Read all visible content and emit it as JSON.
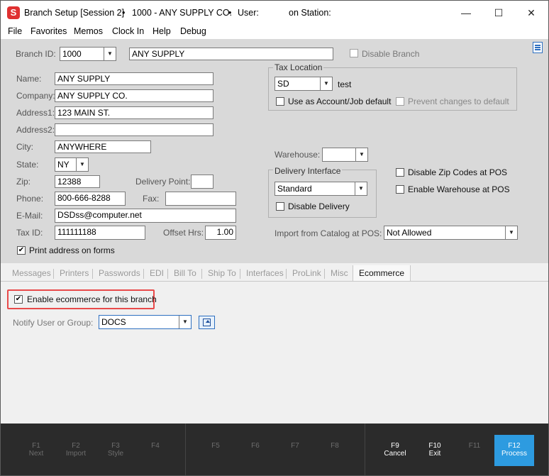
{
  "window": {
    "title_app": "Branch Setup [Session 2]",
    "title_bullet1": "•",
    "title_branch": "1000 - ANY SUPPLY CO.",
    "title_bullet2": "•",
    "title_user_label": "User:",
    "title_station_label": "on Station:",
    "minimize": "—",
    "maximize": "☐",
    "close": "✕"
  },
  "menu": [
    "File",
    "Favorites",
    "Memos",
    "Clock In",
    "Help",
    "Debug"
  ],
  "form": {
    "branch_id_label": "Branch ID:",
    "branch_id": "1000",
    "branch_name": "ANY SUPPLY",
    "disable_branch": "Disable Branch",
    "name_label": "Name:",
    "name": "ANY SUPPLY",
    "company_label": "Company:",
    "company": "ANY SUPPLY CO.",
    "address1_label": "Address1:",
    "address1": "123 MAIN ST.",
    "address2_label": "Address2:",
    "address2": "",
    "city_label": "City:",
    "city": "ANYWHERE",
    "state_label": "State:",
    "state": "NY",
    "zip_label": "Zip:",
    "zip": "12388",
    "delivery_point_label": "Delivery Point:",
    "delivery_point": "",
    "phone_label": "Phone:",
    "phone": "800-666-8288",
    "fax_label": "Fax:",
    "fax": "",
    "email_label": "E-Mail:",
    "email": "DSDss@computer.net",
    "tax_id_label": "Tax ID:",
    "tax_id": "111111188",
    "offset_hrs_label": "Offset Hrs:",
    "offset_hrs": "1.00",
    "print_address": "Print address on forms",
    "tax_location_title": "Tax Location",
    "tax_location": "SD",
    "tax_location_desc": "test",
    "use_as_default": "Use as Account/Job default",
    "prevent_changes": "Prevent changes to default",
    "warehouse_label": "Warehouse:",
    "warehouse": "",
    "delivery_interface_title": "Delivery Interface",
    "delivery_interface": "Standard",
    "disable_delivery": "Disable Delivery",
    "disable_zip": "Disable Zip Codes at POS",
    "enable_warehouse": "Enable Warehouse at POS",
    "import_catalog_label": "Import from Catalog at POS:",
    "import_catalog": "Not Allowed"
  },
  "tabs": [
    "Messages",
    "Printers",
    "Passwords",
    "EDI",
    "Bill To",
    "Ship To",
    "Interfaces",
    "ProLink",
    "Misc"
  ],
  "active_tab": "Ecommerce",
  "ecommerce": {
    "enable_label": "Enable ecommerce for this branch",
    "notify_label": "Notify User or Group:",
    "notify_value": "DOCS"
  },
  "fkeys": [
    {
      "key": "F1",
      "label": "Next"
    },
    {
      "key": "F2",
      "label": "Import"
    },
    {
      "key": "F3",
      "label": "Style"
    },
    {
      "key": "F4",
      "label": ""
    },
    {
      "key": "F5",
      "label": ""
    },
    {
      "key": "F6",
      "label": ""
    },
    {
      "key": "F7",
      "label": ""
    },
    {
      "key": "F8",
      "label": ""
    },
    {
      "key": "F9",
      "label": "Cancel"
    },
    {
      "key": "F10",
      "label": "Exit"
    },
    {
      "key": "F11",
      "label": ""
    },
    {
      "key": "F12",
      "label": "Process"
    }
  ],
  "colors": {
    "accent": "#2d9be0",
    "highlight": "#e84a4a",
    "footer_bg": "#2b2b2b",
    "app_icon": "#e03131"
  },
  "icons": {
    "app": "app-logo-icon",
    "panel": "hamburger-menu-icon",
    "lookup": "lookup-icon"
  },
  "app_icon_letter": "S",
  "checkmark": "✔"
}
